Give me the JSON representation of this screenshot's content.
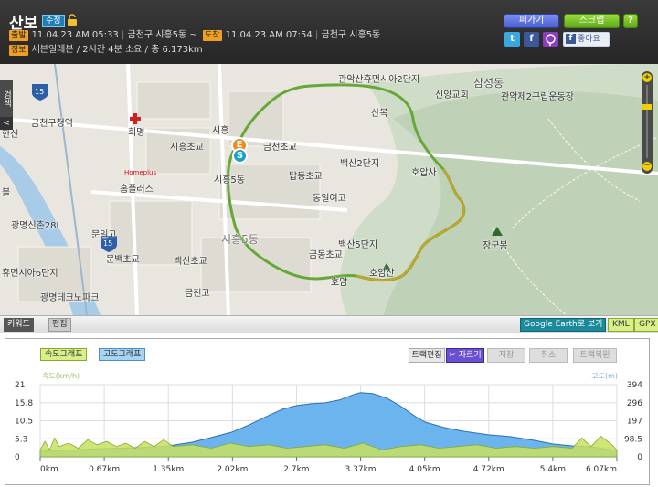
{
  "header": {
    "title": "산보",
    "edit_badge": "수정",
    "start_tag": "출발",
    "start_time": "11.04.23 AM 05:33",
    "start_place": "금천구 시흥5동",
    "tilde": "~",
    "arrive_tag": "도착",
    "arrive_time": "11.04.23 AM 07:54",
    "arrive_place": "금천구 시흥5동",
    "info_tag": "정보",
    "info_text": "세븐일레븐 / 2시간 4분 소요 / 총 6.173km",
    "sep": "|",
    "send_label": "퍼가기",
    "scrap_label": "스크랩",
    "help_label": "?",
    "like_label": "좋아요",
    "twitter_label": "t",
    "facebook_label": "f"
  },
  "map": {
    "search_tab": "검색",
    "search_arrow": "<",
    "start_marker": "S",
    "end_marker": "E",
    "labels": [
      "관악산휴먼시아2단지",
      "삼성동",
      "신양교회",
      "관악제2구립운동장",
      "산복",
      "금천구청역",
      "한신",
      "희명",
      "시흥",
      "시흥초교",
      "금천초교",
      "시흥5동",
      "Homeplus",
      "홈플러스",
      "탑동초교",
      "백산2단지",
      "호압사",
      "동일여고",
      "블",
      "광명신촌28L",
      "문일고",
      "문백초교",
      "시흥5동",
      "백산5단지",
      "장군봉",
      "금동초교",
      "휴먼시아6단지",
      "백산초교",
      "호암산",
      "광명테크노파크",
      "금천고",
      "호암",
      "15",
      "15"
    ]
  },
  "toolbar": {
    "keyword_label": "키워드",
    "edit_label": "편집",
    "google_earth_label": "Google Earth로 보기",
    "kml_label": "KML",
    "gpx_label": "GPX"
  },
  "graph": {
    "speed_tab": "속도그래프",
    "elevation_tab": "고도그래프",
    "track_edit_label": "트랙편집",
    "cut_label": "✂ 자르기",
    "save_label": "저장",
    "cancel_label": "취소",
    "restore_label": "트랙복원",
    "left_axis_label": "속도(km/h)",
    "right_axis_label": "고도(m)"
  },
  "chart_data": {
    "type": "area",
    "x_ticks": [
      "0km",
      "0.67km",
      "1.35km",
      "2.02km",
      "2.7km",
      "3.37km",
      "4.05km",
      "4.72km",
      "5.4km",
      "6.07km"
    ],
    "y_left_ticks": [
      "21",
      "15.8",
      "10.5",
      "5.3",
      "0"
    ],
    "y_right_ticks": [
      "394",
      "296",
      "197",
      "98.5",
      "0"
    ],
    "ylim_left": [
      0,
      21
    ],
    "ylim_right": [
      0,
      394
    ],
    "xlim": [
      0,
      6.07
    ],
    "series": [
      {
        "name": "고도(m)",
        "axis": "right",
        "color": "#6cb4ee",
        "x": [
          0,
          0.2,
          0.4,
          0.67,
          0.9,
          1.1,
          1.35,
          1.6,
          1.8,
          2.02,
          2.2,
          2.4,
          2.55,
          2.7,
          2.85,
          3.0,
          3.15,
          3.3,
          3.37,
          3.5,
          3.65,
          3.8,
          3.95,
          4.05,
          4.25,
          4.45,
          4.72,
          4.95,
          5.2,
          5.4,
          5.6,
          5.8,
          6.07
        ],
        "values": [
          30,
          35,
          40,
          45,
          48,
          52,
          60,
          80,
          105,
          135,
          175,
          225,
          260,
          280,
          290,
          295,
          310,
          340,
          350,
          345,
          320,
          275,
          220,
          190,
          160,
          140,
          120,
          110,
          90,
          70,
          60,
          55,
          35
        ]
      },
      {
        "name": "속도(km/h)",
        "axis": "left",
        "color": "#c8e060",
        "x": [
          0,
          0.05,
          0.1,
          0.15,
          0.2,
          0.3,
          0.4,
          0.5,
          0.6,
          0.7,
          0.8,
          0.9,
          1.0,
          1.1,
          1.2,
          1.3,
          1.4,
          1.6,
          1.8,
          2.0,
          2.2,
          2.4,
          2.6,
          2.8,
          3.0,
          3.2,
          3.4,
          3.6,
          3.8,
          4.0,
          4.2,
          4.4,
          4.6,
          4.8,
          5.0,
          5.2,
          5.4,
          5.6,
          5.7,
          5.8,
          5.9,
          6.0,
          6.07
        ],
        "values": [
          2,
          4.5,
          2,
          5.5,
          3,
          4,
          2.5,
          5,
          3.5,
          4.5,
          3,
          4,
          2.5,
          4.5,
          3,
          5,
          3,
          3.5,
          2.5,
          4,
          3,
          3.5,
          2.5,
          3,
          3.5,
          2.5,
          4,
          2,
          3,
          3.5,
          2.5,
          3,
          3.5,
          2.5,
          3,
          2.5,
          3,
          2.5,
          5.5,
          3,
          6,
          4,
          2
        ]
      }
    ]
  }
}
